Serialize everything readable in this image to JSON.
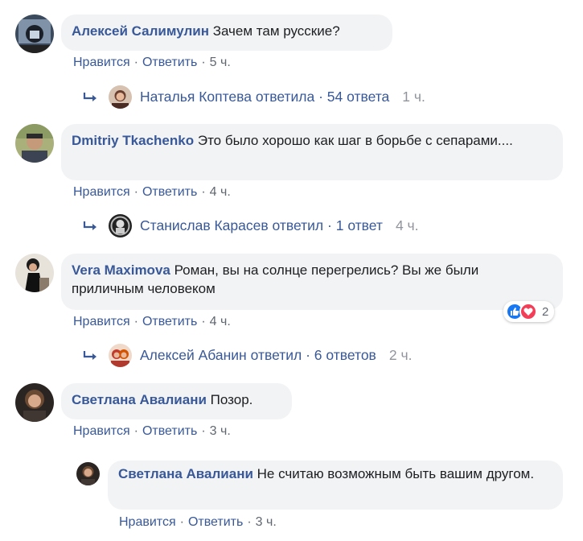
{
  "comments": [
    {
      "author": "Алексей Салимулин",
      "text": "Зачем там русские?",
      "like_label": "Нравится",
      "reply_label": "Ответить",
      "time": "5 ч.",
      "replies_summary": {
        "author": "Наталья Коптева",
        "verb": "ответила",
        "count": "54 ответа",
        "time": "1 ч."
      }
    },
    {
      "author": "Dmitriy Tkachenko",
      "text": "Это было хорошо как шаг в борьбе с сепарами....",
      "like_label": "Нравится",
      "reply_label": "Ответить",
      "time": "4 ч.",
      "replies_summary": {
        "author": "Станислав Карасев",
        "verb": "ответил",
        "count": "1 ответ",
        "time": "4 ч."
      }
    },
    {
      "author": "Vera Maximova",
      "text": "Роман, вы на солнце перегрелись? Вы же были приличным человеком",
      "like_label": "Нравится",
      "reply_label": "Ответить",
      "time": "4 ч.",
      "reactions": {
        "icons": [
          "like-icon",
          "love-icon"
        ],
        "count": "2",
        "like_color": "#1877f2",
        "love_color": "#f33e58"
      },
      "replies_summary": {
        "author": "Алексей Абанин",
        "verb": "ответил",
        "count": "6 ответов",
        "time": "2 ч."
      }
    },
    {
      "author": "Светлана Авалиани",
      "text": "Позор.",
      "like_label": "Нравится",
      "reply_label": "Ответить",
      "time": "3 ч.",
      "nested_reply": {
        "author": "Светлана Авалиани",
        "text": "Не считаю возможным быть вашим другом.",
        "like_label": "Нравится",
        "reply_label": "Ответить",
        "time": "3 ч."
      }
    }
  ],
  "colors": {
    "link": "#385898",
    "bubble": "#f2f3f5",
    "meta": "#606770",
    "muted": "#90949c"
  }
}
